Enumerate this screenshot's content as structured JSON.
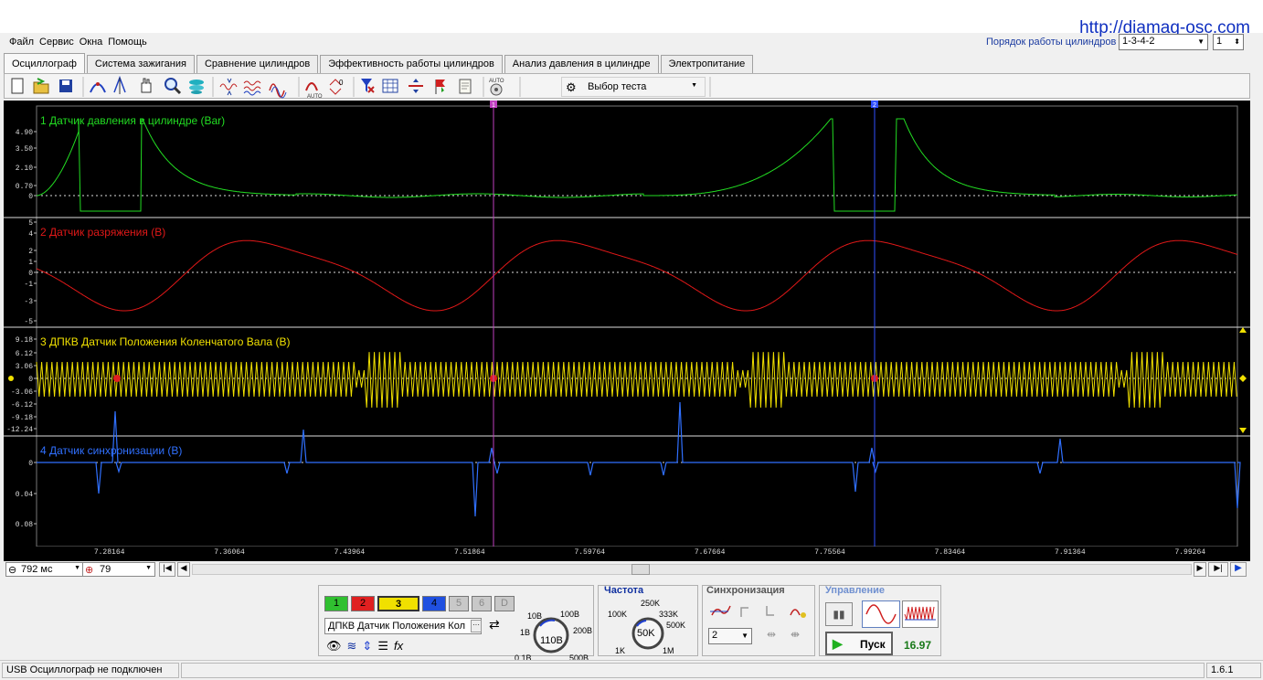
{
  "url": "http://diamag-osc.com",
  "menu": [
    "Файл",
    "Сервис",
    "Окна",
    "Помощь"
  ],
  "firing_order": {
    "label": "Порядок работы цилиндров",
    "value": "1-3-4-2",
    "cylinder": "1"
  },
  "tabs": [
    "Осциллограф",
    "Система зажигания",
    "Сравнение цилиндров",
    "Эффективность работы цилиндров",
    "Анализ давления в цилиндре",
    "Электропитание"
  ],
  "active_tab": 0,
  "toolbar": {
    "test_select": "Выбор теста",
    "icons": [
      "new-file-icon",
      "open-folder-icon",
      "save-icon",
      "cursor-arc-icon",
      "cursor-vertical-icon",
      "hand-icon",
      "zoom-icon",
      "layers-icon",
      "compress-icon",
      "wave-icon",
      "wave-multi-icon",
      "auto-scale-icon",
      "zero-scale-icon",
      "filter-icon",
      "grid-icon",
      "split-icon",
      "marker-icon",
      "notes-icon",
      "auto-set-icon"
    ]
  },
  "channels": [
    {
      "title": "1 Датчик давления в цилиндре (Bar)",
      "color": "#22dd22",
      "ticks": [
        "4.90",
        "3.50",
        "2.10",
        "0.70",
        "0"
      ]
    },
    {
      "title": "2 Датчик разряжения (В)",
      "color": "#e01818",
      "ticks": [
        "5",
        "4",
        "2",
        "1",
        "0",
        "-1",
        "-3",
        "-5"
      ]
    },
    {
      "title": "3 ДПКВ Датчик Положения Коленчатого Вала (В)",
      "color": "#f0e000",
      "ticks": [
        "9.18",
        "6.12",
        "3.06",
        "0",
        "-3.06",
        "-6.12",
        "-9.18",
        "-12.24"
      ]
    },
    {
      "title": "4 Датчик синхронизации (В)",
      "color": "#3070ff",
      "ticks": [
        "0",
        "0.04",
        "0.08"
      ]
    }
  ],
  "cursors": {
    "c1": "1",
    "c2": "2"
  },
  "x_ticks": [
    "7.28164",
    "7.36064",
    "7.43964",
    "7.51864",
    "7.59764",
    "7.67664",
    "7.75564",
    "7.83464",
    "7.91364",
    "7.99264"
  ],
  "nav": {
    "timebase": "792 мс",
    "frame": "79"
  },
  "channel_panel": {
    "buttons": [
      "1",
      "2",
      "3",
      "4",
      "5",
      "6",
      "D"
    ],
    "selected_name": "ДПКВ Датчик Положения Кол",
    "volt": {
      "value": "110В",
      "labels": [
        "10В",
        "100В",
        "1В",
        "200В",
        "0.1В",
        "500В"
      ]
    }
  },
  "frequency": {
    "title": "Частота",
    "value": "50K",
    "labels": [
      "250K",
      "100K",
      "333K",
      "500K",
      "1K",
      "1M"
    ]
  },
  "sync": {
    "title": "Синхронизация",
    "channel": "2"
  },
  "control": {
    "title": "Управление",
    "start": "Пуск",
    "fps": "16.97"
  },
  "status": {
    "connection": "USB Осциллограф не подключен",
    "version": "1.6.1"
  }
}
